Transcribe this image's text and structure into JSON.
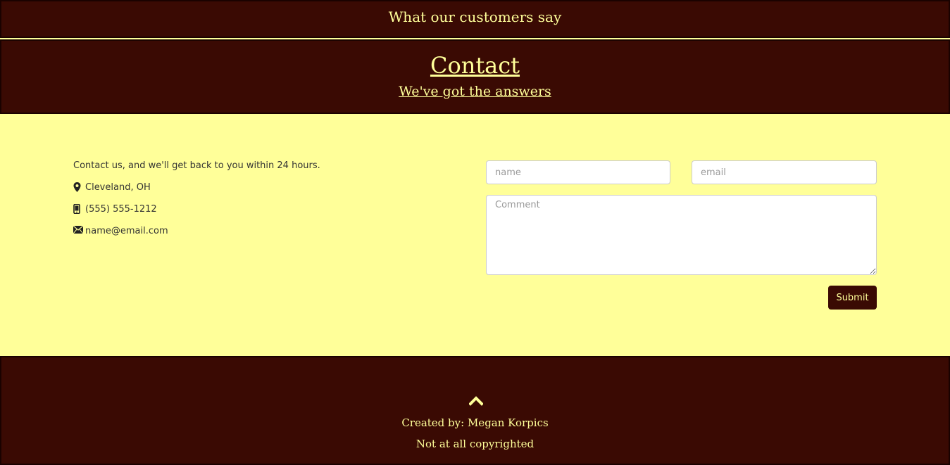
{
  "testimonials": {
    "title": "What our customers say"
  },
  "contact": {
    "heading": "Contact",
    "subheading": "We've got the answers",
    "intro": "Contact us, and we'll get back to you within 24 hours.",
    "location": "Cleveland, OH",
    "phone": "(555) 555-1212",
    "email": "name@email.com",
    "icons": [
      "map-marker-icon",
      "phone-icon",
      "envelope-icon"
    ]
  },
  "form": {
    "name_placeholder": "name",
    "email_placeholder": "email",
    "comment_placeholder": "Comment",
    "submit_label": "Submit"
  },
  "footer": {
    "icon": "chevron-up-icon",
    "credit": "Created by: Megan Korpics",
    "copyright": "Not at all copyrighted"
  },
  "colors": {
    "band_background": "#3a0a03",
    "band_text": "#ffff99",
    "section_background": "#ffff99"
  }
}
